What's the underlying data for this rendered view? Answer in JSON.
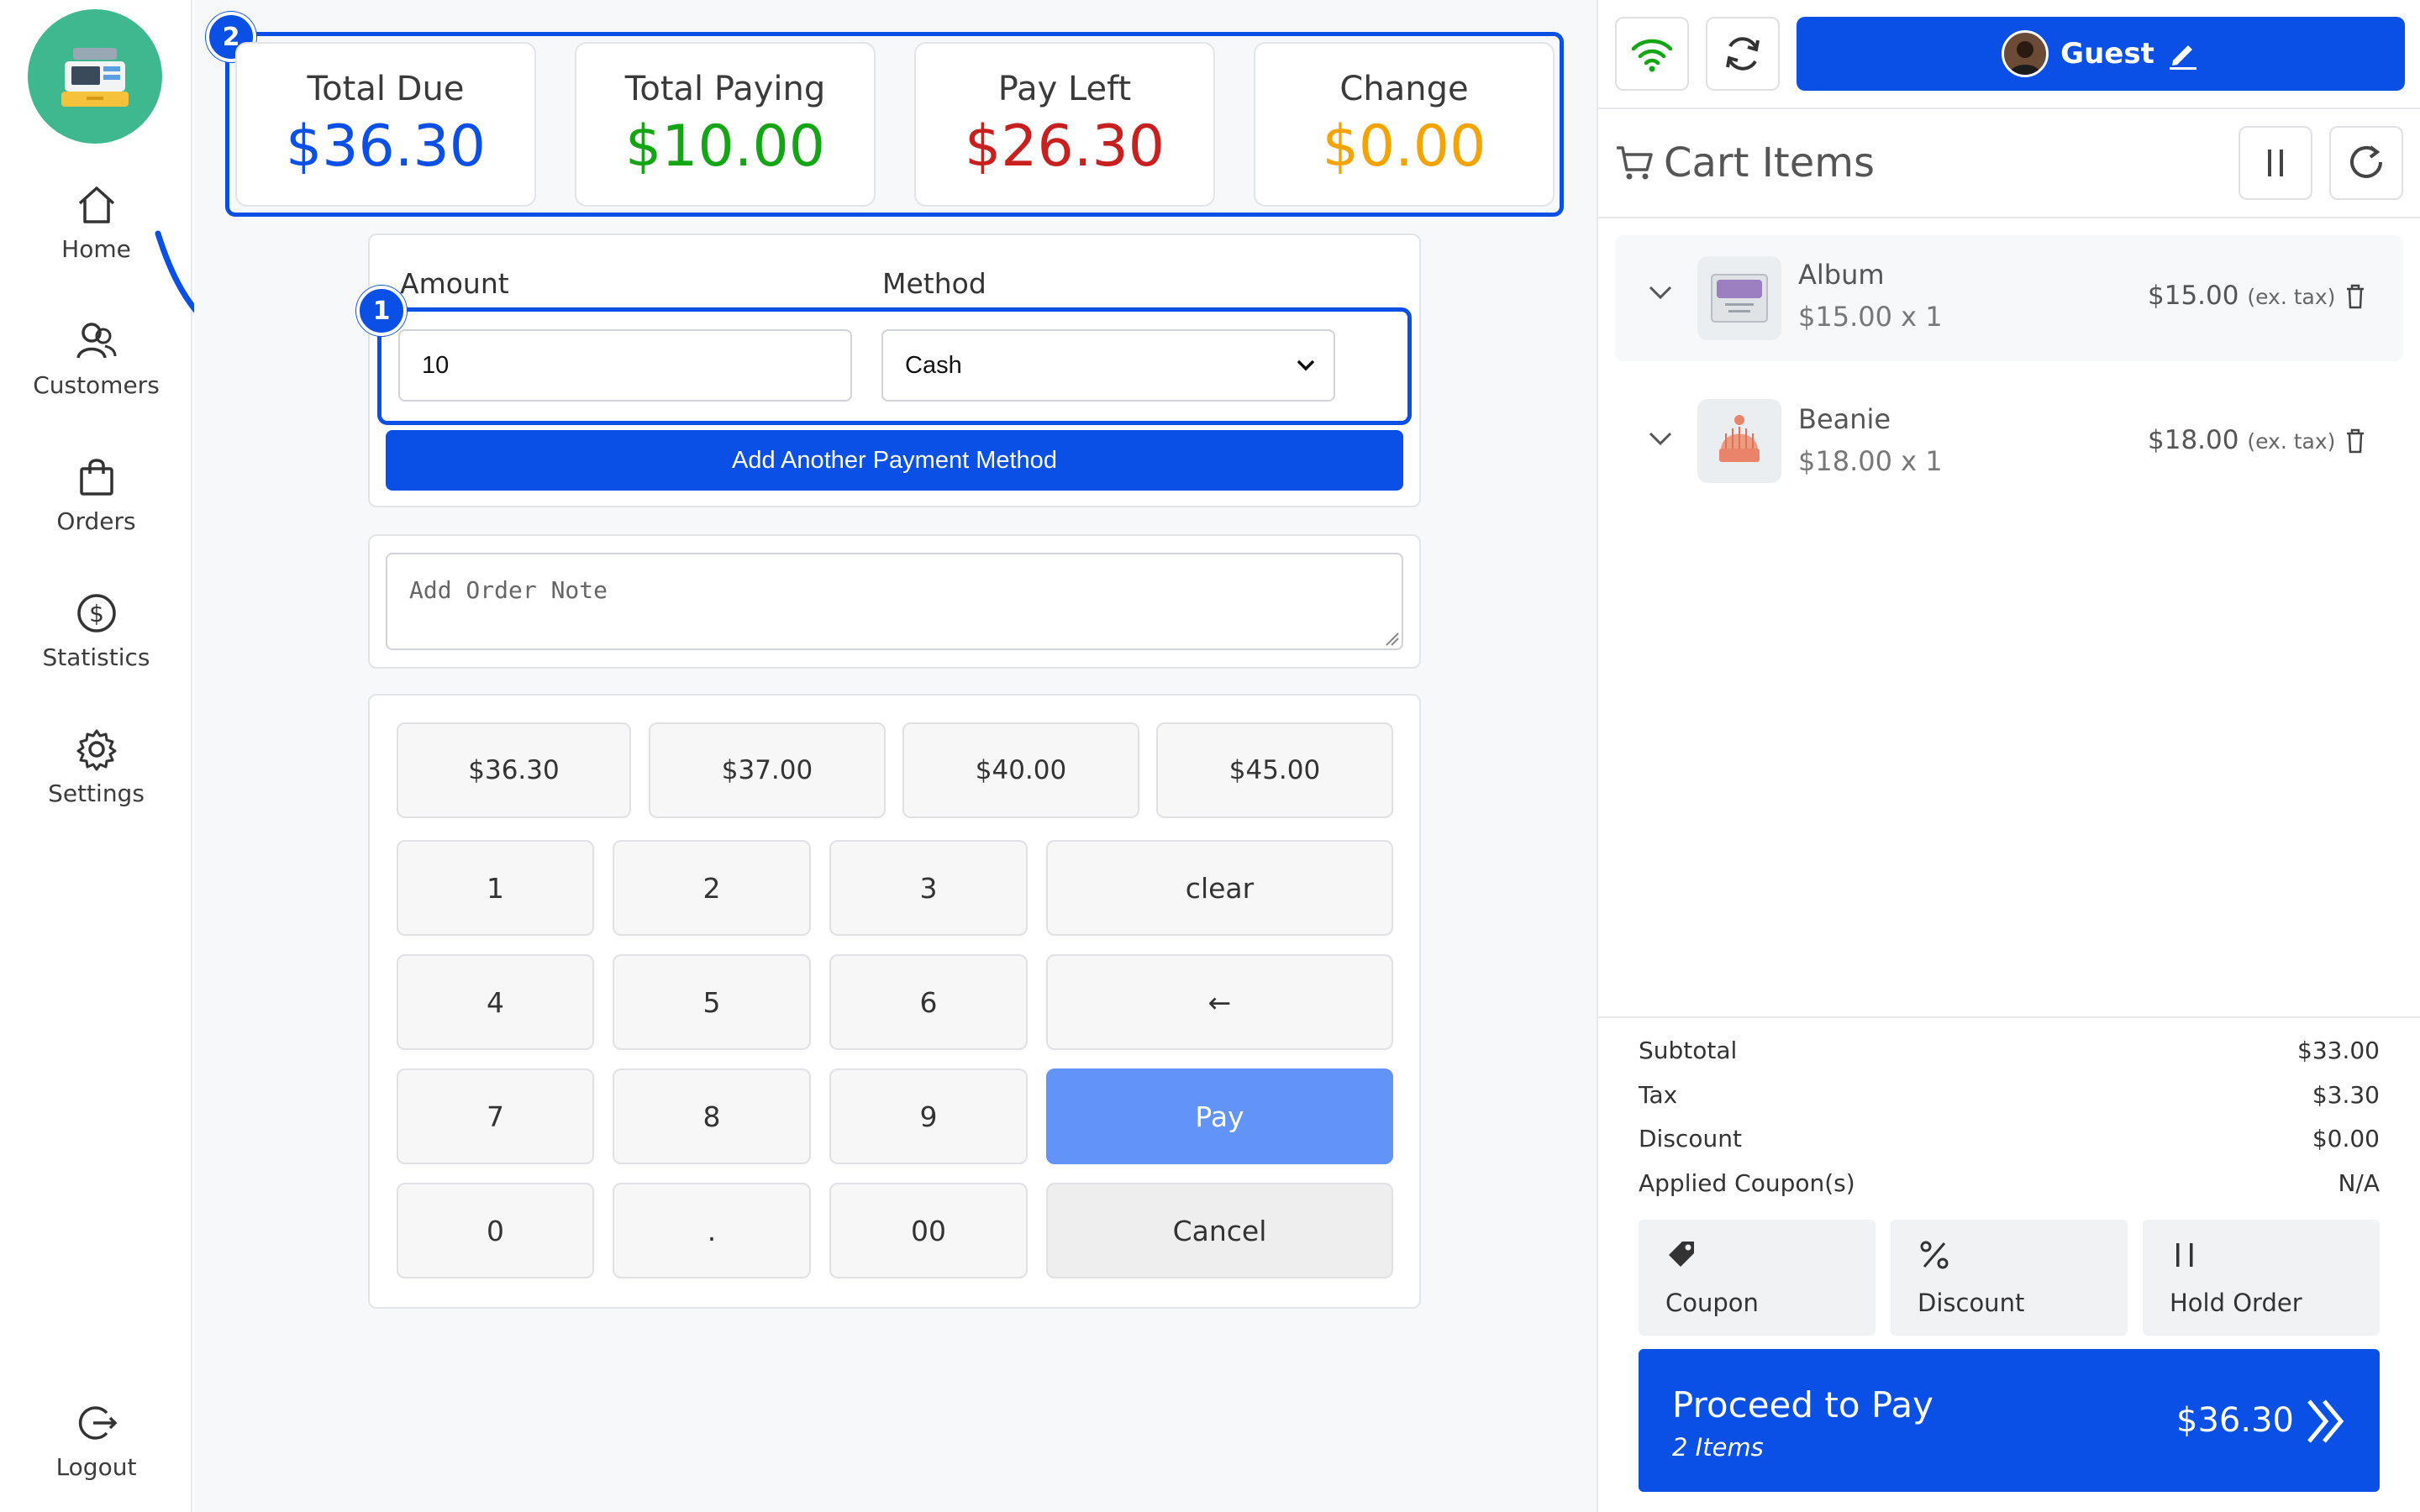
{
  "sidebar": {
    "items": [
      {
        "label": "Home",
        "icon": "home-icon"
      },
      {
        "label": "Customers",
        "icon": "customers-icon"
      },
      {
        "label": "Orders",
        "icon": "shopping-bag-icon"
      },
      {
        "label": "Statistics",
        "icon": "dollar-circle-icon"
      },
      {
        "label": "Settings",
        "icon": "gear-icon"
      }
    ],
    "logout": "Logout"
  },
  "summary": {
    "badge": "2",
    "cards": [
      {
        "title": "Total Due",
        "value": "$36.30",
        "color": "#0a4fe6"
      },
      {
        "title": "Total Paying",
        "value": "$10.00",
        "color": "#14a514"
      },
      {
        "title": "Pay Left",
        "value": "$26.30",
        "color": "#c8201f"
      },
      {
        "title": "Change",
        "value": "$0.00",
        "color": "#f5a300"
      }
    ]
  },
  "payment": {
    "badge": "1",
    "amount_label": "Amount",
    "method_label": "Method",
    "amount_value": "10",
    "method_value": "Cash",
    "add_method_label": "Add Another Payment Method"
  },
  "note": {
    "placeholder": "Add Order Note"
  },
  "keypad": {
    "quick": [
      "$36.30",
      "$37.00",
      "$40.00",
      "$45.00"
    ],
    "digits": [
      "1",
      "2",
      "3",
      "4",
      "5",
      "6",
      "7",
      "8",
      "9",
      "0",
      ".",
      "00"
    ],
    "clear": "clear",
    "backspace": "←",
    "pay": "Pay",
    "cancel": "Cancel"
  },
  "topbar": {
    "guest_label": "Guest"
  },
  "cart": {
    "title": "Cart Items",
    "items": [
      {
        "name": "Album",
        "qty": "$15.00 x 1",
        "price": "$15.00",
        "tax_note": "(ex. tax)"
      },
      {
        "name": "Beanie",
        "qty": "$18.00 x 1",
        "price": "$18.00",
        "tax_note": "(ex. tax)"
      }
    ]
  },
  "totals": [
    {
      "label": "Subtotal",
      "value": "$33.00"
    },
    {
      "label": "Tax",
      "value": "$3.30"
    },
    {
      "label": "Discount",
      "value": "$0.00"
    },
    {
      "label": "Applied Coupon(s)",
      "value": "N/A"
    }
  ],
  "actions": [
    {
      "label": "Coupon",
      "icon": "tag-icon"
    },
    {
      "label": "Discount",
      "icon": "percent-icon"
    },
    {
      "label": "Hold Order",
      "icon": "pause-icon"
    }
  ],
  "proceed": {
    "label": "Proceed to Pay",
    "items": "2 Items",
    "amount": "$36.30"
  },
  "colors": {
    "accent": "#0a4fe6",
    "pay_button": "#6293f7",
    "logo_bg": "#3fb88f"
  }
}
